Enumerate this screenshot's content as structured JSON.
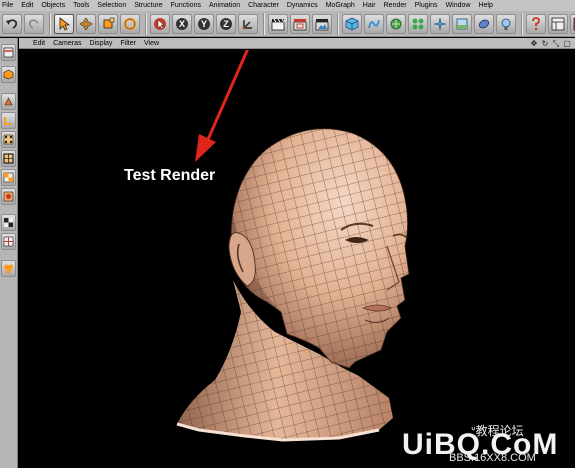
{
  "menubar": {
    "items": [
      "File",
      "Edit",
      "Objects",
      "Tools",
      "Selection",
      "Structure",
      "Functions",
      "Animation",
      "Character",
      "Dynamics",
      "MoGraph",
      "Hair",
      "Render",
      "Plugins",
      "Window",
      "Help"
    ]
  },
  "toolbar": {
    "axis_x": "X",
    "axis_y": "Y",
    "axis_z": "Z"
  },
  "viewport_menu": {
    "items": [
      "Edit",
      "Cameras",
      "Display",
      "Filter",
      "View"
    ],
    "nav_icons": [
      "✥",
      "↻",
      "⤡",
      "▢"
    ]
  },
  "annotation": {
    "label": "Test Render",
    "color": "#e0261b"
  },
  "watermark": {
    "logo": "UiBQ.CoM",
    "top_text": "ᐡ教程论坛",
    "url": "BBS.16XX8.COM"
  },
  "colors": {
    "skin": "#e8bfa3",
    "background": "#000000",
    "ui_gray": "#b6b6b6"
  }
}
